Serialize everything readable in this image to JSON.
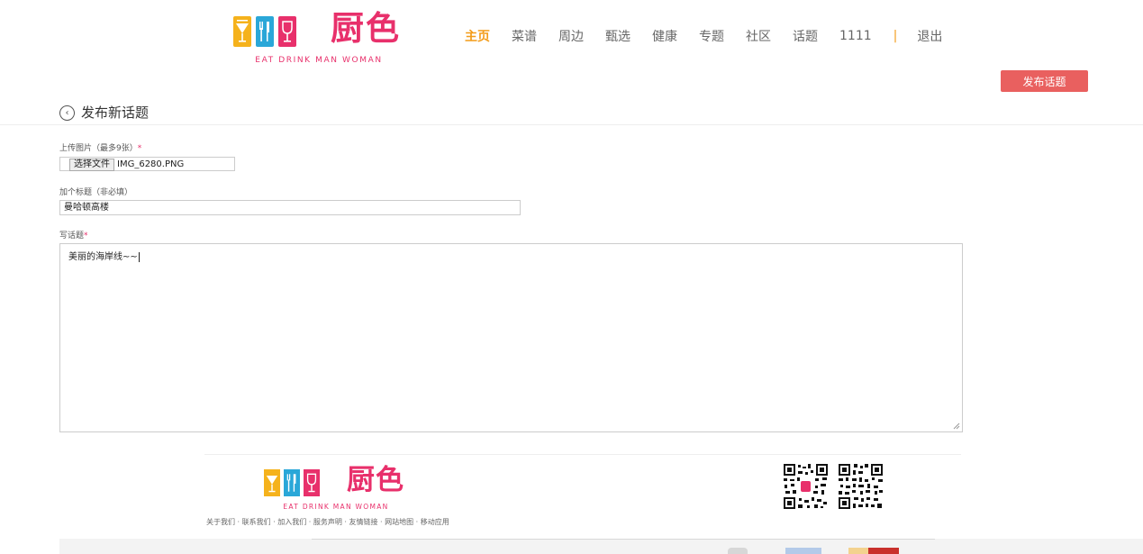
{
  "brand": {
    "name": "厨色",
    "tagline": "EAT DRINK MAN WOMAN",
    "colors": {
      "cup1": "#f5b21c",
      "cup2": "#2aa7d8",
      "cup3": "#e8306b",
      "brand": "#e8306b"
    }
  },
  "nav": {
    "items": [
      "主页",
      "菜谱",
      "周边",
      "甄选",
      "健康",
      "专题",
      "社区",
      "话题"
    ],
    "active_index": 0,
    "username": "1111",
    "separator": "|",
    "logout": "退出",
    "active_color": "#f39c1a"
  },
  "publish_button": {
    "label": "发布话题",
    "color": "#e9605f"
  },
  "page": {
    "back_icon": "chevron-left-circle-icon",
    "title": "发布新话题"
  },
  "form": {
    "upload": {
      "label": "上传图片（最多9张）",
      "required_mark": "*",
      "button_label": "选择文件",
      "file_name": "IMG_6280.PNG"
    },
    "title_field": {
      "label": "加个标题（非必填）",
      "value": "曼哈顿高楼"
    },
    "body_field": {
      "label": "写话题",
      "required_mark": "*",
      "value": "美丽的海岸线~~"
    }
  },
  "footer": {
    "brand": "厨色",
    "tagline": "EAT DRINK MAN WOMAN",
    "links": "关于我们 · 联系我们 · 加入我们 · 服务声明 · 友情链接 · 网站地图 · 移动应用",
    "qr_icons": [
      "qr-code-icon",
      "qr-code-icon"
    ]
  }
}
